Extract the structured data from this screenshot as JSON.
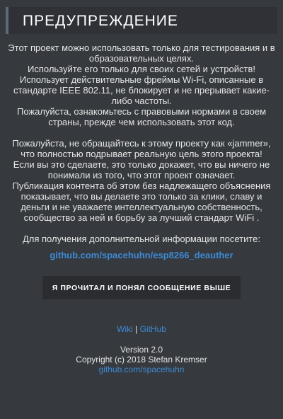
{
  "header": {
    "title": "ПРЕДУПРЕЖДЕНИЕ"
  },
  "warning": {
    "paragraphs1": [
      "Этот проект можно использовать только для тестирования и в образовательных целях.",
      "Используйте его только для своих сетей и устройств!",
      "Использует действительные фреймы Wi-Fi, описанные в стандарте IEEE 802.11, не блокирует и не прерывает какие-либо частоты.",
      "Пожалуйста, ознакомьтесь с правовыми нормами в своем страны, прежде чем использовать этот код."
    ],
    "paragraphs2": [
      "Пожалуйста, не обращайтесь к этому проекту как «jammer», что полностью подрывает реальную цель этого проекта!",
      "Если вы это сделаете, это только докажет, что вы ничего не понимали из того, что этот проект означает.",
      "Публикация контента об этом без надлежащего объяснения показывает, что вы делаете это только за клики, славу и деньги и не уважаете интеллектуальную собственность, сообщество за ней и борьбу за лучший стандарт WiFi ."
    ],
    "info_text": "Для получения дополнительной информации посетите:",
    "info_link": "github.com/spacehuhn/esp8266_deauther"
  },
  "ack_button": {
    "label": "Я ПРОЧИТАЛ И ПОНЯЛ СООБЩЕНИЕ ВЫШЕ"
  },
  "footer": {
    "wiki_label": "Wiki",
    "separator": "|",
    "github_label": "GitHub",
    "version": "Version 2.0",
    "copyright": "Copyright (c) 2018 Stefan Kremser",
    "profile_link": "github.com/spacehuhn"
  },
  "colors": {
    "background": "#36393e",
    "header_background": "#2f3136",
    "accent": "#3d8bd5",
    "button_background": "#2a2c30"
  }
}
